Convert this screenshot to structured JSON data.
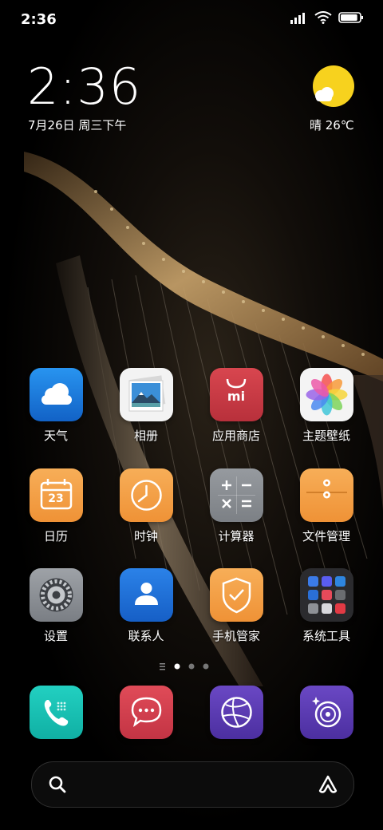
{
  "status_bar": {
    "time": "2:36",
    "battery_level": 0.9
  },
  "clock_widget": {
    "time": "2:36",
    "date": "7月26日 周三下午"
  },
  "weather_widget": {
    "text": "晴 26℃",
    "icon": "sun-cloud-icon"
  },
  "apps_grid": [
    {
      "label": "天气",
      "icon": "weather-icon"
    },
    {
      "label": "相册",
      "icon": "gallery-icon"
    },
    {
      "label": "应用商店",
      "icon": "app-store-icon"
    },
    {
      "label": "主题壁纸",
      "icon": "themes-icon"
    },
    {
      "label": "日历",
      "icon": "calendar-icon",
      "icon_text": "23"
    },
    {
      "label": "时钟",
      "icon": "clock-icon"
    },
    {
      "label": "计算器",
      "icon": "calculator-icon"
    },
    {
      "label": "文件管理",
      "icon": "file-manager-icon"
    },
    {
      "label": "设置",
      "icon": "settings-icon"
    },
    {
      "label": "联系人",
      "icon": "contacts-icon"
    },
    {
      "label": "手机管家",
      "icon": "security-icon"
    },
    {
      "label": "系统工具",
      "icon": "tools-folder-icon"
    }
  ],
  "app_store_logo_text": "mi",
  "pager": {
    "pages": 3,
    "current": 1
  },
  "dock": [
    {
      "name": "phone",
      "icon": "phone-icon"
    },
    {
      "name": "messages",
      "icon": "messages-icon"
    },
    {
      "name": "browser",
      "icon": "browser-icon"
    },
    {
      "name": "camera",
      "icon": "camera-icon"
    }
  ],
  "search_bar": {
    "search_icon": "search-icon",
    "assistant_icon": "assistant-icon"
  },
  "colors": {
    "weather": "#1a7fe0",
    "store": "#c93a44",
    "orange": "#f4a24a",
    "gray": "#8b8e93",
    "contacts": "#1d6fd8",
    "teal": "#1bc5b7",
    "red": "#d8424f",
    "purple": "#5a3bb0"
  }
}
